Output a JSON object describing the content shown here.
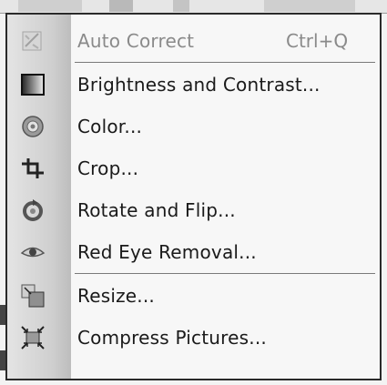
{
  "menu": {
    "items": [
      {
        "label": "Auto Correct",
        "shortcut": "Ctrl+Q",
        "icon": "auto-correct-icon",
        "enabled": false
      },
      {
        "label": "Brightness and Contrast...",
        "icon": "brightness-contrast-icon",
        "enabled": true
      },
      {
        "label": "Color...",
        "icon": "color-icon",
        "enabled": true
      },
      {
        "label": "Crop...",
        "icon": "crop-icon",
        "enabled": true
      },
      {
        "label": "Rotate and Flip...",
        "icon": "rotate-flip-icon",
        "enabled": true
      },
      {
        "label": "Red Eye Removal...",
        "icon": "red-eye-icon",
        "enabled": true
      },
      {
        "label": "Resize...",
        "icon": "resize-icon",
        "enabled": true
      },
      {
        "label": "Compress Pictures...",
        "icon": "compress-pictures-icon",
        "enabled": true
      }
    ]
  },
  "colors": {
    "menu_background": "#f7f7f7",
    "gutter": "#cfcfcf",
    "text": "#1a1a1a",
    "disabled_text": "#8a8a8a"
  }
}
